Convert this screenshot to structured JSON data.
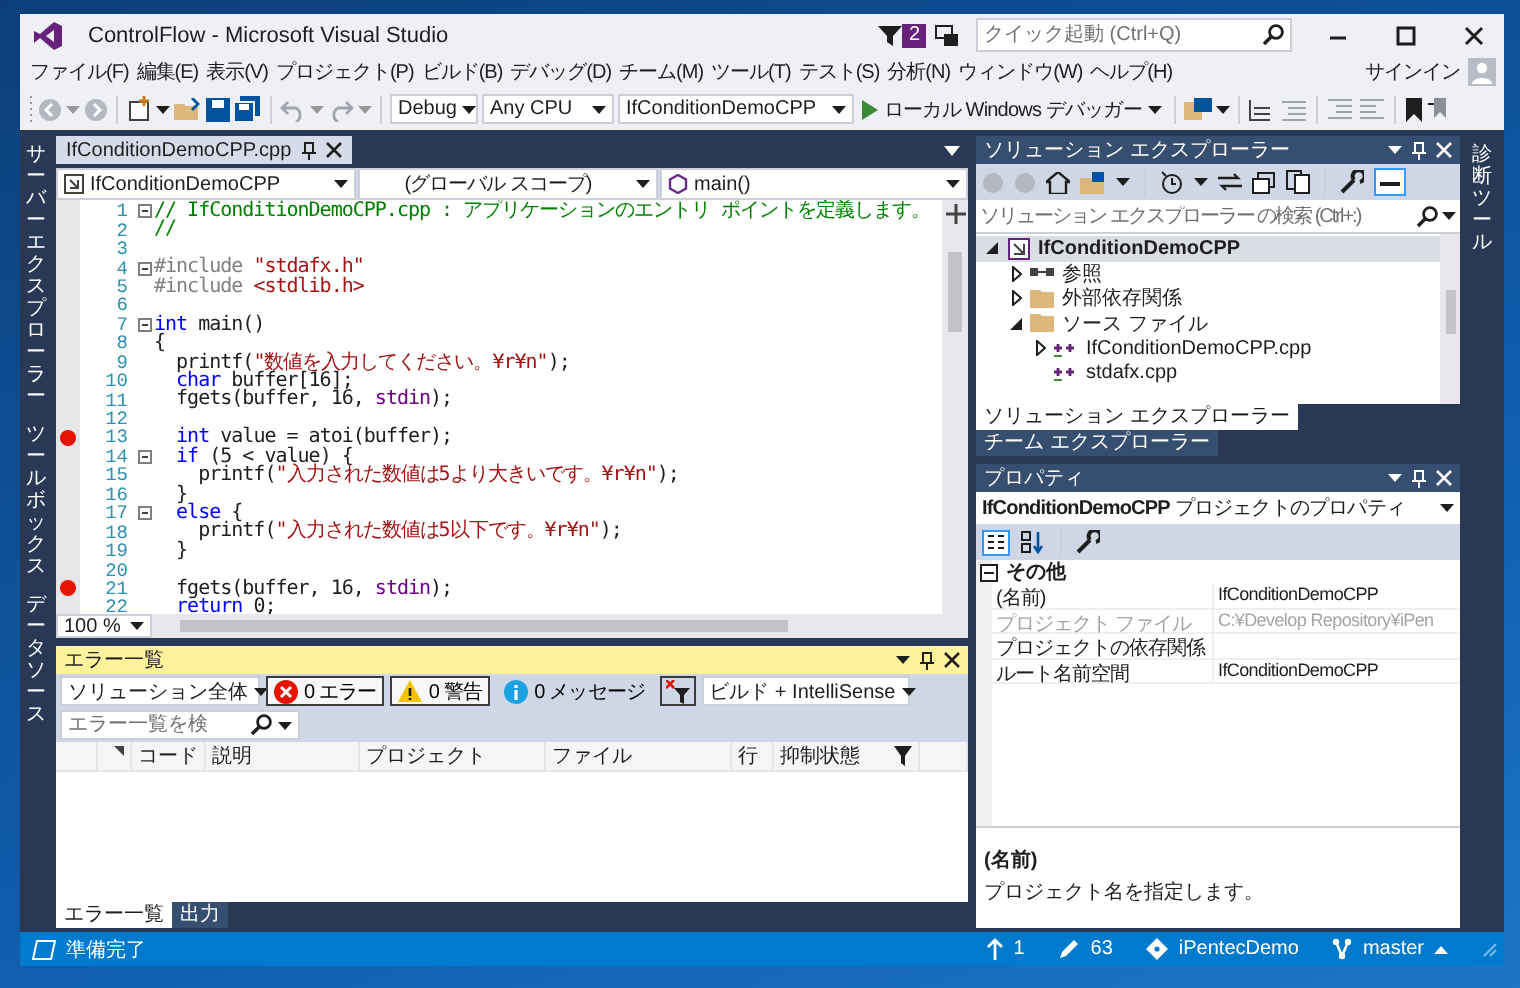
{
  "window": {
    "title": "ControlFlow - Microsoft Visual Studio",
    "notification_count": "2",
    "quick_launch": {
      "placeholder": "クイック起動 (Ctrl+Q)"
    },
    "sign_in": "サインイン"
  },
  "menu": [
    "ファイル(F)",
    "編集(E)",
    "表示(V)",
    "プロジェクト(P)",
    "ビルド(B)",
    "デバッグ(D)",
    "チーム(M)",
    "ツール(T)",
    "テスト(S)",
    "分析(N)",
    "ウィンドウ(W)",
    "ヘルプ(H)"
  ],
  "toolbar": {
    "configuration": "Debug",
    "platform": "Any CPU",
    "startup_project": "IfConditionDemoCPP",
    "run_button": "ローカル Windows デバッガー"
  },
  "side_tabs_left": [
    "サーバーエクスプローラー",
    "ツールボックス",
    "データソース"
  ],
  "side_tabs_right": [
    "診断ツール"
  ],
  "editor": {
    "tabs": [
      {
        "label": "IfConditionDemoCPP.cpp",
        "selected": true
      }
    ],
    "nav": {
      "project": "IfConditionDemoCPP",
      "scope": "(グローバル スコープ)",
      "member": "main()"
    },
    "lines": [
      {
        "number": "1",
        "breakpoint": false,
        "fold": true,
        "tokens": [
          {
            "kind": "comment",
            "text": "// IfConditionDemoCPP.cpp : アプリケーションのエントリ ポイントを定義します。"
          }
        ]
      },
      {
        "number": "2",
        "breakpoint": false,
        "fold": false,
        "tokens": [
          {
            "kind": "comment",
            "text": "//"
          }
        ]
      },
      {
        "number": "3",
        "breakpoint": false,
        "fold": false
      },
      {
        "number": "4",
        "breakpoint": false,
        "fold": true,
        "tokens": [
          {
            "kind": "preprocessor",
            "text": "#include "
          },
          {
            "kind": "string",
            "text": "\"stdafx.h\""
          }
        ]
      },
      {
        "number": "5",
        "breakpoint": false,
        "fold": false,
        "tokens": [
          {
            "kind": "preprocessor",
            "text": "#include "
          },
          {
            "kind": "string",
            "text": "<stdlib.h>"
          }
        ]
      },
      {
        "number": "6",
        "breakpoint": false,
        "fold": false
      },
      {
        "number": "7",
        "breakpoint": false,
        "fold": true,
        "tokens": [
          {
            "kind": "keyword",
            "text": "int"
          },
          {
            "kind": "plain",
            "text": " main()"
          }
        ]
      },
      {
        "number": "8",
        "breakpoint": false,
        "fold": false,
        "tokens": [
          {
            "kind": "plain",
            "text": "{"
          }
        ]
      },
      {
        "number": "9",
        "breakpoint": false,
        "fold": false,
        "tokens": [
          {
            "kind": "plain",
            "text": "  printf("
          },
          {
            "kind": "string",
            "text": "\"数値を入力してください。¥r¥n\""
          },
          {
            "kind": "plain",
            "text": ");"
          }
        ]
      },
      {
        "number": "10",
        "breakpoint": false,
        "fold": false,
        "tokens": [
          {
            "kind": "keyword",
            "text": "  char"
          },
          {
            "kind": "plain",
            "text": " buffer[16];"
          }
        ]
      },
      {
        "number": "11",
        "breakpoint": false,
        "fold": false,
        "tokens": [
          {
            "kind": "plain",
            "text": "  fgets(buffer, 16, "
          },
          {
            "kind": "macro",
            "text": "stdin"
          },
          {
            "kind": "plain",
            "text": ");"
          }
        ]
      },
      {
        "number": "12",
        "breakpoint": false,
        "fold": false
      },
      {
        "number": "13",
        "breakpoint": true,
        "fold": false,
        "tokens": [
          {
            "kind": "keyword",
            "text": "  int"
          },
          {
            "kind": "plain",
            "text": " value = atoi(buffer);"
          }
        ]
      },
      {
        "number": "14",
        "breakpoint": false,
        "fold": true,
        "tokens": [
          {
            "kind": "keyword",
            "text": "  if"
          },
          {
            "kind": "plain",
            "text": " (5 < value) {"
          }
        ]
      },
      {
        "number": "15",
        "breakpoint": false,
        "fold": false,
        "tokens": [
          {
            "kind": "plain",
            "text": "    printf("
          },
          {
            "kind": "string",
            "text": "\"入力された数値は5より大きいです。¥r¥n\""
          },
          {
            "kind": "plain",
            "text": ");"
          }
        ]
      },
      {
        "number": "16",
        "breakpoint": false,
        "fold": false,
        "tokens": [
          {
            "kind": "plain",
            "text": "  }"
          }
        ]
      },
      {
        "number": "17",
        "breakpoint": false,
        "fold": true,
        "tokens": [
          {
            "kind": "keyword",
            "text": "  else"
          },
          {
            "kind": "plain",
            "text": " {"
          }
        ]
      },
      {
        "number": "18",
        "breakpoint": false,
        "fold": false,
        "tokens": [
          {
            "kind": "plain",
            "text": "    printf("
          },
          {
            "kind": "string",
            "text": "\"入力された数値は5以下です。¥r¥n\""
          },
          {
            "kind": "plain",
            "text": ");"
          }
        ]
      },
      {
        "number": "19",
        "breakpoint": false,
        "fold": false,
        "tokens": [
          {
            "kind": "plain",
            "text": "  }"
          }
        ]
      },
      {
        "number": "20",
        "breakpoint": false,
        "fold": false
      },
      {
        "number": "21",
        "breakpoint": true,
        "fold": false,
        "tokens": [
          {
            "kind": "plain",
            "text": "  fgets(buffer, 16, "
          },
          {
            "kind": "macro",
            "text": "stdin"
          },
          {
            "kind": "plain",
            "text": ");"
          }
        ]
      },
      {
        "number": "22",
        "breakpoint": false,
        "fold": false,
        "tokens": [
          {
            "kind": "keyword",
            "text": "  return"
          },
          {
            "kind": "plain",
            "text": " 0;"
          }
        ]
      }
    ],
    "zoom": "100 %"
  },
  "error_list": {
    "title": "エラー一覧",
    "scope": "ソリューション全体",
    "filters": [
      {
        "kind": "error",
        "label": "0 エラー",
        "selected": true
      },
      {
        "kind": "warning",
        "label": "0 警告",
        "selected": true
      },
      {
        "kind": "info",
        "label": "0 メッセージ",
        "selected": false
      }
    ],
    "source": "ビルド + IntelliSense",
    "search": {
      "placeholder": "エラー一覧を検"
    },
    "columns": [
      "コード",
      "説明",
      "プロジェクト",
      "ファイル",
      "行",
      "抑制状態"
    ],
    "tabs": [
      {
        "label": "エラー一覧",
        "selected": true
      },
      {
        "label": "出力",
        "selected": false
      }
    ]
  },
  "solution_explorer": {
    "title": "ソリューション エクスプローラー",
    "search": {
      "placeholder": "ソリューション エクスプローラー の検索 (Ctrl+:)"
    },
    "tree": [
      {
        "label": "IfConditionDemoCPP",
        "kind": "project",
        "expandable": true,
        "expanded": true,
        "selected": true,
        "children": [
          {
            "label": "参照",
            "kind": "references",
            "expandable": true,
            "expanded": false,
            "selected": false
          },
          {
            "label": "外部依存関係",
            "kind": "folder",
            "expandable": true,
            "expanded": false,
            "selected": false
          },
          {
            "label": "ソース ファイル",
            "kind": "folder",
            "expandable": true,
            "expanded": true,
            "selected": false,
            "children": [
              {
                "label": "IfConditionDemoCPP.cpp",
                "kind": "cpp",
                "expandable": true,
                "expanded": false,
                "selected": false
              },
              {
                "label": "stdafx.cpp",
                "kind": "cpp",
                "expandable": false,
                "selected": false
              }
            ]
          }
        ]
      }
    ],
    "tabs": [
      {
        "label": "ソリューション エクスプローラー",
        "selected": true
      },
      {
        "label": "チーム エクスプローラー",
        "selected": false
      }
    ]
  },
  "properties": {
    "title": "プロパティ",
    "object": "**IfConditionDemoCPP** プロジェクトのプロパティ",
    "category": "その他",
    "rows": [
      {
        "name": "(名前)",
        "value": "IfConditionDemoCPP",
        "disabled": false
      },
      {
        "name": "プロジェクト ファイル",
        "value": "C:¥Develop Repository¥iPen",
        "disabled": true
      },
      {
        "name": "プロジェクトの依存関係",
        "disabled": false
      },
      {
        "name": "ルート名前空間",
        "value": "IfConditionDemoCPP",
        "disabled": false
      }
    ],
    "description": {
      "title": "(名前)",
      "text": "プロジェクト名を指定します。"
    }
  },
  "status_bar": {
    "message": "準備完了",
    "pushes": "1",
    "changes": "63",
    "repository": "iPentecDemo",
    "branch": "master"
  }
}
